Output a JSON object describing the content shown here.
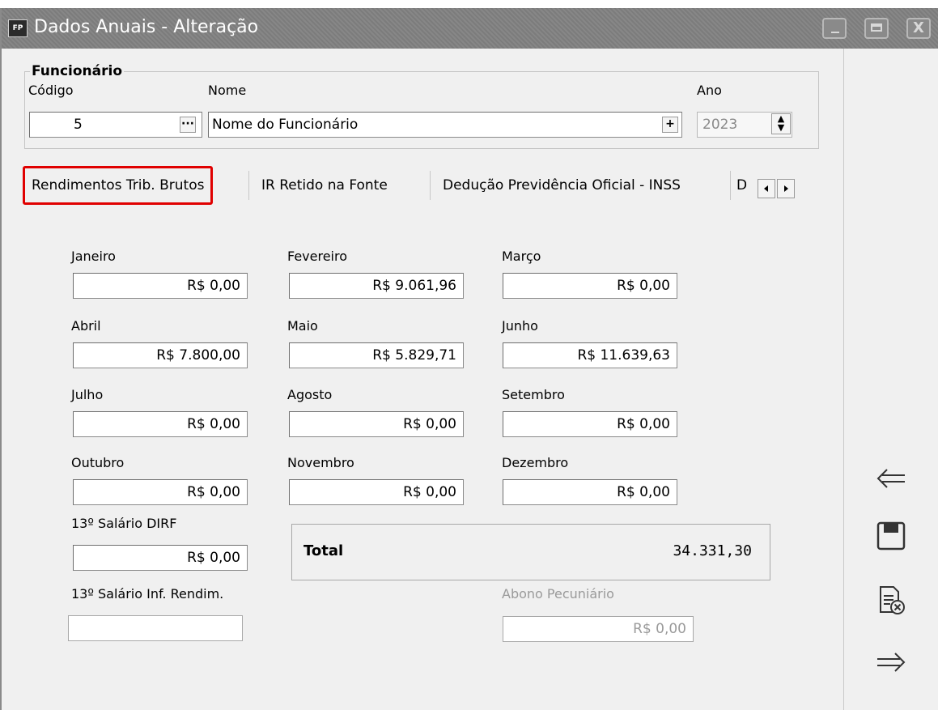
{
  "window": {
    "title": "Dados Anuais - Alteração",
    "icon_text": "FP",
    "close_glyph": "X"
  },
  "funcionario": {
    "legend": "Funcionário",
    "codigo_label": "Código",
    "codigo_value": "5",
    "codigo_btn": "···",
    "nome_label": "Nome",
    "nome_value": "Nome do Funcionário",
    "nome_btn": "+",
    "ano_label": "Ano",
    "ano_value": "2023"
  },
  "tabs": [
    {
      "label": "Rendimentos Trib. Brutos",
      "active": true
    },
    {
      "label": "IR Retido na Fonte"
    },
    {
      "label": "Dedução Previdência Oficial - INSS"
    },
    {
      "label": "D"
    }
  ],
  "months": [
    {
      "label": "Janeiro",
      "value": "R$ 0,00"
    },
    {
      "label": "Fevereiro",
      "value": "R$ 9.061,96"
    },
    {
      "label": "Março",
      "value": "R$ 0,00"
    },
    {
      "label": "Abril",
      "value": "R$ 7.800,00"
    },
    {
      "label": "Maio",
      "value": "R$ 5.829,71"
    },
    {
      "label": "Junho",
      "value": "R$ 11.639,63"
    },
    {
      "label": "Julho",
      "value": "R$ 0,00"
    },
    {
      "label": "Agosto",
      "value": "R$ 0,00"
    },
    {
      "label": "Setembro",
      "value": "R$ 0,00"
    },
    {
      "label": "Outubro",
      "value": "R$ 0,00"
    },
    {
      "label": "Novembro",
      "value": "R$ 0,00"
    },
    {
      "label": "Dezembro",
      "value": "R$ 0,00"
    }
  ],
  "decimo_dirf": {
    "label": "13º Salário DIRF",
    "value": "R$ 0,00"
  },
  "decimo_inf": {
    "label": "13º Salário Inf. Rendim.",
    "value": ""
  },
  "total": {
    "label": "Total",
    "value": "34.331,30"
  },
  "abono": {
    "label": "Abono Pecuniário",
    "value": "R$ 0,00"
  },
  "side_icons": [
    "arrow-left-icon",
    "save-icon",
    "cancel-document-icon",
    "arrow-right-icon"
  ]
}
